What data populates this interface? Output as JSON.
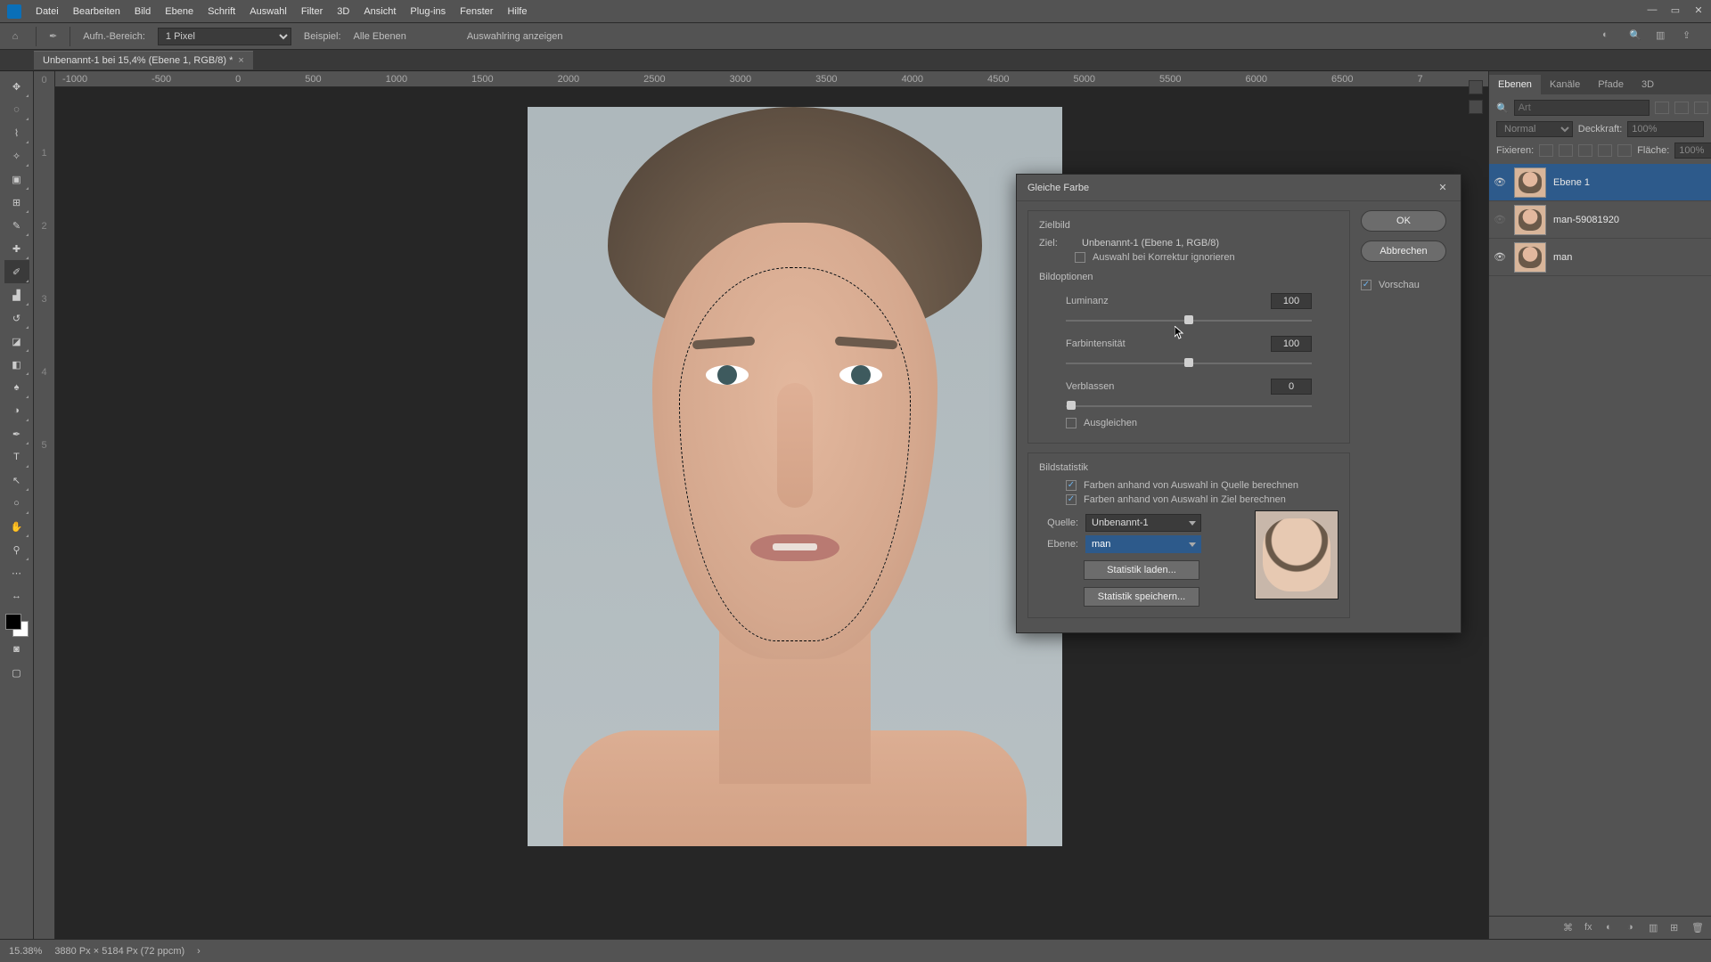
{
  "menu": {
    "items": [
      "Datei",
      "Bearbeiten",
      "Bild",
      "Ebene",
      "Schrift",
      "Auswahl",
      "Filter",
      "3D",
      "Ansicht",
      "Plug-ins",
      "Fenster",
      "Hilfe"
    ]
  },
  "optbar": {
    "label1": "Aufn.-Bereich:",
    "pixel_sel": "1 Pixel",
    "label2": "Beispiel:",
    "all_layers": "Alle Ebenen",
    "show_ring": "Auswahlring anzeigen"
  },
  "doc": {
    "tab": "Unbenannt-1 bei 15,4% (Ebene 1, RGB/8) *"
  },
  "ruler": [
    "-1000",
    "-500",
    "0",
    "500",
    "1000",
    "1500",
    "2000",
    "2500",
    "3000",
    "3500",
    "4000",
    "4500",
    "5000",
    "5500",
    "6000",
    "6500",
    "7"
  ],
  "vruler": [
    "0",
    "1",
    "2",
    "3",
    "4",
    "5"
  ],
  "panels": {
    "tabs": [
      "Ebenen",
      "Kanäle",
      "Pfade",
      "3D"
    ],
    "mode": "Normal",
    "opacity_lbl": "Deckkraft:",
    "opacity": "100%",
    "fix_lbl": "Fixieren:",
    "fill_lbl": "Fläche:",
    "fill": "100%",
    "search_ph": "Art",
    "layers": [
      {
        "name": "Ebene 1",
        "vis": true,
        "sel": true
      },
      {
        "name": "man-59081920",
        "vis": false,
        "sel": false
      },
      {
        "name": "man",
        "vis": true,
        "sel": false
      }
    ]
  },
  "status": {
    "zoom": "15.38%",
    "info": "3880 Px × 5184 Px (72 ppcm)"
  },
  "dialog": {
    "title": "Gleiche Farbe",
    "ok": "OK",
    "cancel": "Abbrechen",
    "preview": "Vorschau",
    "sect_target": "Zielbild",
    "target_lbl": "Ziel:",
    "target_val": "Unbenannt-1 (Ebene 1, RGB/8)",
    "ignore_sel": "Auswahl bei Korrektur ignorieren",
    "sect_imgopt": "Bildoptionen",
    "luminance_lbl": "Luminanz",
    "luminance": "100",
    "intensity_lbl": "Farbintensität",
    "intensity": "100",
    "fade_lbl": "Verblassen",
    "fade": "0",
    "neutralize": "Ausgleichen",
    "sect_stats": "Bildstatistik",
    "use_src_sel": "Farben anhand von Auswahl in Quelle berechnen",
    "use_tgt_sel": "Farben anhand von Auswahl in Ziel berechnen",
    "source_lbl": "Quelle:",
    "source_val": "Unbenannt-1",
    "layer_lbl": "Ebene:",
    "layer_val": "man",
    "load_stats": "Statistik laden...",
    "save_stats": "Statistik speichern..."
  }
}
